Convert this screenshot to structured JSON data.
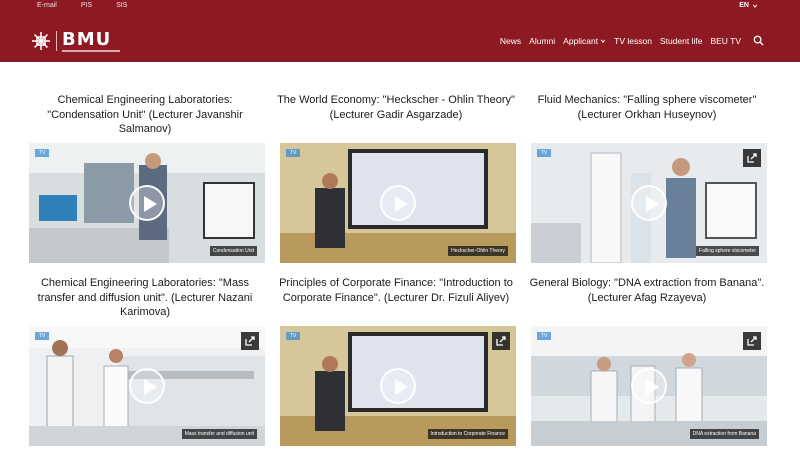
{
  "top_links": [
    "E-mail",
    "PIS",
    "SIS"
  ],
  "language": "EN",
  "logo": {
    "text": "BMU"
  },
  "nav": {
    "items": [
      {
        "label": "News",
        "dropdown": false
      },
      {
        "label": "Alumni",
        "dropdown": false
      },
      {
        "label": "Applicant",
        "dropdown": true
      },
      {
        "label": "TV lesson",
        "dropdown": false
      },
      {
        "label": "Student life",
        "dropdown": false
      },
      {
        "label": "BEU TV",
        "dropdown": false
      }
    ],
    "search_icon": "search-icon"
  },
  "colors": {
    "header": "#8d1a22",
    "accent": "#3c8cd2"
  },
  "videos": [
    {
      "title": "Chemical Engineering Laboratories: \"Condensation Unit\" (Lecturer Javanshir Salmanov)",
      "caption": "Condensation Unit",
      "share": false,
      "scene": "lab"
    },
    {
      "title": "The World Economy: \"Heckscher - Ohlin Theory\" (Lecturer Gadir Asgarzade)",
      "caption": "Heckscher-Ohlin Theory",
      "share": false,
      "scene": "board"
    },
    {
      "title": "Fluid Mechanics: \"Falling sphere viscometer\" (Lecturer Orkhan Huseynov)",
      "caption": "Falling sphere viscometer",
      "share": true,
      "scene": "lab2"
    },
    {
      "title": "Chemical Engineering Laboratories: \"Mass transfer and diffusion unit\". (Lecturer Nazani Karimova)",
      "caption": "Mass transfer and diffusion unit",
      "share": true,
      "scene": "lab3"
    },
    {
      "title": "Principles of Corporate Finance: \"Introduction to Corporate Finance\". (Lecturer Dr. Fizuli Aliyev)",
      "caption": "Introduction to Corporate Finance",
      "share": true,
      "scene": "board"
    },
    {
      "title": "General Biology: \"DNA extraction from Banana\". (Lecturer Afag Rzayeva)",
      "caption": "DNA extraction from Banana",
      "share": true,
      "scene": "lab4"
    }
  ]
}
